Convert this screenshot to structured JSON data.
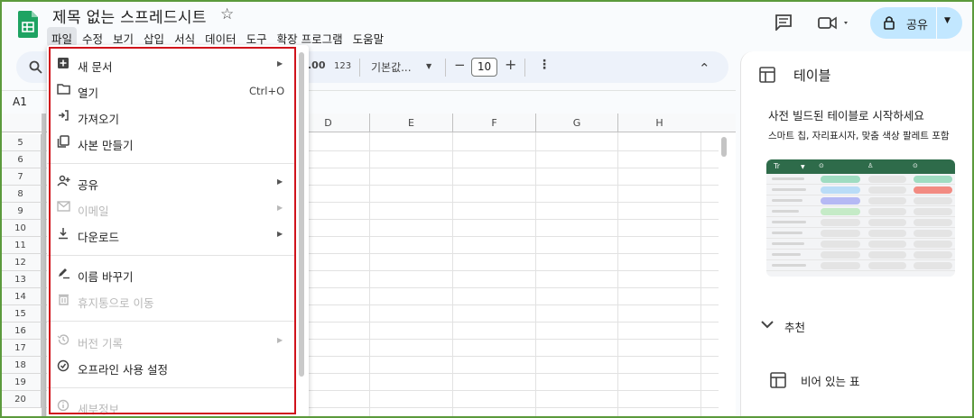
{
  "app": {
    "doc_title": "제목 없는 스프레드시트",
    "menubar": [
      "파일",
      "수정",
      "보기",
      "삽입",
      "서식",
      "데이터",
      "도구",
      "확장 프로그램",
      "도움말"
    ],
    "share_label": "공유"
  },
  "toolbar": {
    "decimal_label": ".00",
    "number_format_label": "123",
    "font_label": "기본값...",
    "font_size": "10",
    "minus": "−",
    "plus": "+",
    "more": "⋮",
    "collapse": "⌃"
  },
  "formula": {
    "cell_ref": "A1"
  },
  "grid": {
    "columns": [
      "D",
      "E",
      "F",
      "G",
      "H"
    ],
    "rows": [
      "5",
      "6",
      "7",
      "8",
      "9",
      "10",
      "11",
      "12",
      "13",
      "14",
      "15",
      "16",
      "17",
      "18",
      "19",
      "20"
    ]
  },
  "file_menu": {
    "items": [
      {
        "label": "새 문서",
        "shortcut": "",
        "submenu": true,
        "disabled": false,
        "icon": "new-doc-icon"
      },
      {
        "label": "열기",
        "shortcut": "Ctrl+O",
        "submenu": false,
        "disabled": false,
        "icon": "folder-icon"
      },
      {
        "label": "가져오기",
        "shortcut": "",
        "submenu": false,
        "disabled": false,
        "icon": "import-icon"
      },
      {
        "label": "사본 만들기",
        "shortcut": "",
        "submenu": false,
        "disabled": false,
        "icon": "copy-icon"
      },
      {
        "label": "공유",
        "shortcut": "",
        "submenu": true,
        "disabled": false,
        "icon": "person-add-icon"
      },
      {
        "label": "이메일",
        "shortcut": "",
        "submenu": true,
        "disabled": true,
        "icon": "mail-icon"
      },
      {
        "label": "다운로드",
        "shortcut": "",
        "submenu": true,
        "disabled": false,
        "icon": "download-icon"
      },
      {
        "label": "이름 바꾸기",
        "shortcut": "",
        "submenu": false,
        "disabled": false,
        "icon": "rename-icon"
      },
      {
        "label": "휴지통으로 이동",
        "shortcut": "",
        "submenu": false,
        "disabled": true,
        "icon": "trash-icon"
      },
      {
        "label": "버전 기록",
        "shortcut": "",
        "submenu": true,
        "disabled": true,
        "icon": "history-icon"
      },
      {
        "label": "오프라인 사용 설정",
        "shortcut": "",
        "submenu": false,
        "disabled": false,
        "icon": "offline-icon"
      },
      {
        "label": "세부정보",
        "shortcut": "",
        "submenu": false,
        "disabled": true,
        "icon": "info-icon"
      }
    ]
  },
  "side_panel": {
    "title": "테이블",
    "heading": "사전 빌드된 테이블로 시작하세요",
    "subheading": "스마트 칩, 자리표시자, 맞춤 색상 팔레트 포함",
    "preview_header_label": "Tr",
    "recommended_label": "추천",
    "empty_table_label": "비어 있는 표"
  }
}
